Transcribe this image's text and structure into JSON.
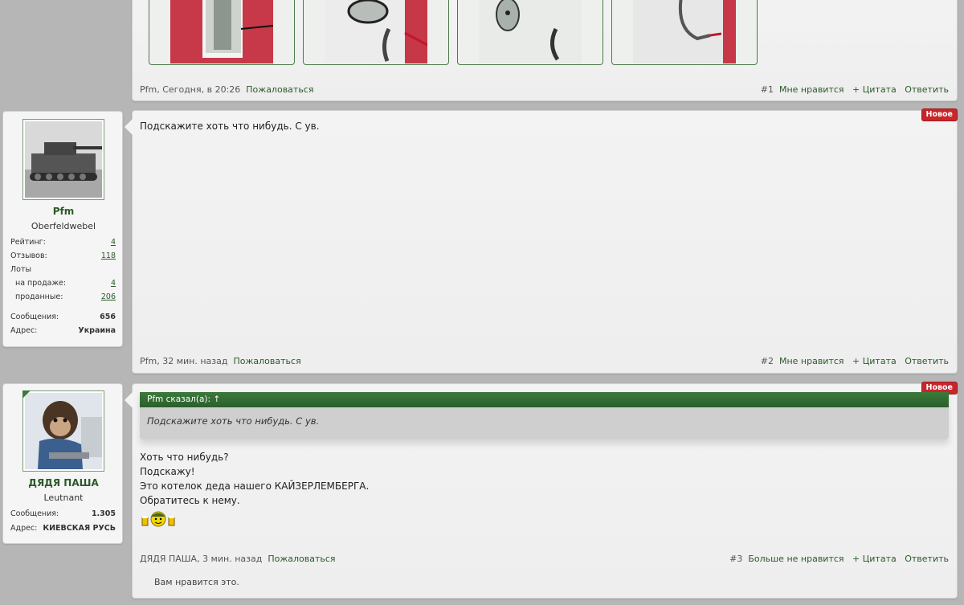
{
  "post1": {
    "author": "Pfm",
    "date": "Сегодня, в 20:26",
    "report": "Пожаловаться",
    "number": "#1",
    "like": "Мне нравится",
    "quote": "+ Цитата",
    "reply": "Ответить"
  },
  "user1": {
    "name": "Pfm",
    "title": "Oberfeldwebel",
    "stats": {
      "rating_label": "Рейтинг:",
      "rating": "4",
      "reviews_label": "Отзывов:",
      "reviews": "118",
      "lots_label": "Лоты",
      "on_sale_label": "на продаже:",
      "on_sale": "4",
      "sold_label": "проданные:",
      "sold": "206",
      "messages_label": "Сообщения:",
      "messages": "656",
      "address_label": "Адрес:",
      "address": "Украина"
    }
  },
  "post2": {
    "badge": "Новое",
    "text": "Подскажите хоть что нибудь. С ув.",
    "author": "Pfm",
    "date": "32 мин. назад",
    "report": "Пожаловаться",
    "number": "#2",
    "like": "Мне нравится",
    "quote": "+ Цитата",
    "reply": "Ответить"
  },
  "user2": {
    "name": "ДЯДЯ ПАША",
    "title": "Leutnant",
    "messages_label": "Сообщения:",
    "messages": "1.305",
    "address_label": "Адрес:",
    "address": "КИЕВСКАЯ РУСЬ"
  },
  "post3": {
    "badge": "Новое",
    "quote_head": "Pfm сказал(а): ↑",
    "quote_text": "Подскажите хоть что нибудь. С ув.",
    "lines": [
      "Хоть что нибудь?",
      "Подскажу!",
      "Это котелок деда нашего КАЙЗЕРЛЕМБЕРГА.",
      "Обратитесь к нему."
    ],
    "author": "ДЯДЯ ПАША",
    "date": "3 мин. назад",
    "report": "Пожаловаться",
    "number": "#3",
    "unlike": "Больше не нравится",
    "quote": "+ Цитата",
    "reply": "Ответить",
    "liked_note": "Вам нравится это."
  },
  "colors": {
    "background": "#b5b6b5",
    "link_green": "#2b5a2b",
    "badge_red": "#c8262b",
    "quote_header": "#2b5f2b"
  }
}
